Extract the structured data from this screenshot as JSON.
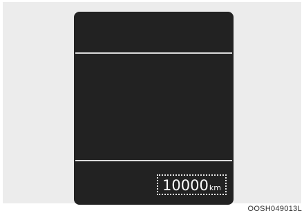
{
  "odometer": {
    "value": "10000",
    "unit": "km"
  },
  "image_code": "OOSH049013L",
  "colors": {
    "display_background": "#222222",
    "divider": "#dcdcdc",
    "frame_background": "#ececec"
  }
}
